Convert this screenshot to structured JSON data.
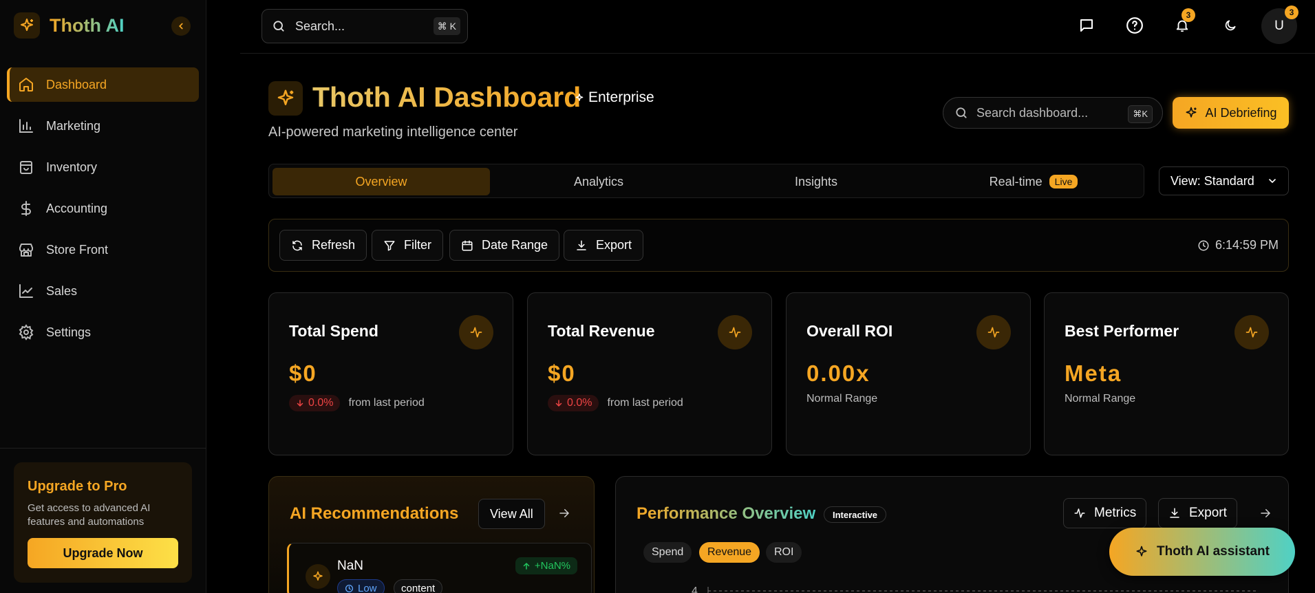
{
  "brand": {
    "name": "Thoth AI"
  },
  "sidebar": {
    "items": [
      {
        "label": "Dashboard",
        "icon": "home-icon",
        "active": true
      },
      {
        "label": "Marketing",
        "icon": "bar-chart-icon"
      },
      {
        "label": "Inventory",
        "icon": "shopping-bag-icon"
      },
      {
        "label": "Accounting",
        "icon": "dollar-icon"
      },
      {
        "label": "Store Front",
        "icon": "store-icon"
      },
      {
        "label": "Sales",
        "icon": "line-chart-icon"
      },
      {
        "label": "Settings",
        "icon": "gear-icon"
      }
    ],
    "upgrade": {
      "title": "Upgrade to Pro",
      "description": "Get access to advanced AI features and automations",
      "button": "Upgrade Now"
    }
  },
  "topbar": {
    "search_placeholder": "Search...",
    "search_shortcut": "⌘ K",
    "notification_count": "3",
    "avatar_initial": "U",
    "avatar_badge": "3"
  },
  "header": {
    "title": "Thoth AI Dashboard",
    "badge": "Enterprise",
    "subtitle": "AI-powered marketing intelligence center",
    "search_placeholder": "Search dashboard...",
    "search_shortcut": "⌘K",
    "debrief_button": "AI Debriefing"
  },
  "tabs": [
    {
      "label": "Overview",
      "active": true
    },
    {
      "label": "Analytics"
    },
    {
      "label": "Insights"
    },
    {
      "label": "Real-time",
      "badge": "Live"
    }
  ],
  "view_select": {
    "value": "View: Standard"
  },
  "toolbar": {
    "refresh": "Refresh",
    "filter": "Filter",
    "date_range": "Date Range",
    "export": "Export",
    "timestamp": "6:14:59 PM"
  },
  "metrics": [
    {
      "title": "Total Spend",
      "value": "$0",
      "delta": "0.0%",
      "delta_note": "from last period"
    },
    {
      "title": "Total Revenue",
      "value": "$0",
      "delta": "0.0%",
      "delta_note": "from last period"
    },
    {
      "title": "Overall ROI",
      "value": "0.00x",
      "note": "Normal Range"
    },
    {
      "title": "Best Performer",
      "value": "Meta",
      "note": "Normal Range"
    }
  ],
  "recommendations": {
    "title": "AI Recommendations",
    "view_all": "View All",
    "item": {
      "title": "NaN",
      "change": "+NaN%",
      "priority": "Low",
      "category": "content"
    }
  },
  "performance": {
    "title": "Performance Overview",
    "tag": "Interactive",
    "metrics_button": "Metrics",
    "export_button": "Export",
    "chips": [
      {
        "label": "Spend"
      },
      {
        "label": "Revenue",
        "active": true
      },
      {
        "label": "ROI"
      }
    ],
    "axis_tick": "4"
  },
  "assistant": {
    "label": "Thoth AI assistant"
  },
  "colors": {
    "accent": "#f5a623",
    "teal": "#4fd1c5",
    "background": "#000000"
  }
}
